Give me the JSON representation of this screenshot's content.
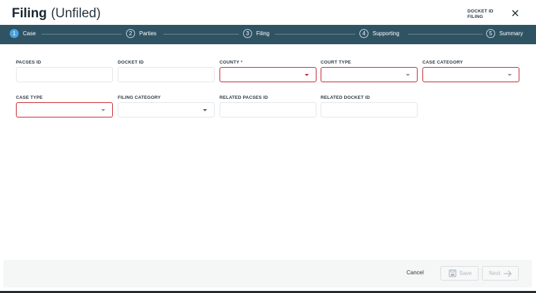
{
  "header": {
    "title": "Filing",
    "subtitle": "(Unfiled)",
    "docket_label": "DOCKET ID",
    "filing_label": "FILING"
  },
  "stepper": {
    "steps": [
      {
        "number": "1",
        "label": "Case",
        "active": true
      },
      {
        "number": "2",
        "label": "Parties",
        "active": false
      },
      {
        "number": "3",
        "label": "Filing",
        "active": false
      },
      {
        "number": "4",
        "label": "Supporting",
        "active": false
      },
      {
        "number": "5",
        "label": "Summary",
        "active": false
      }
    ]
  },
  "form": {
    "pacses_id": {
      "label": "PACSES ID",
      "value": ""
    },
    "docket_id": {
      "label": "DOCKET ID",
      "value": ""
    },
    "county": {
      "label": "COUNTY",
      "required_mark": "*",
      "value": ""
    },
    "court_type": {
      "label": "COURT TYPE",
      "value": ""
    },
    "case_category": {
      "label": "CASE CATEGORY",
      "value": ""
    },
    "case_type": {
      "label": "CASE TYPE",
      "value": ""
    },
    "filing_category": {
      "label": "FILING CATEGORY",
      "value": ""
    },
    "related_pacses_id": {
      "label": "RELATED PACSES ID",
      "value": ""
    },
    "related_docket_id": {
      "label": "RELATED DOCKET ID",
      "value": ""
    }
  },
  "footer": {
    "cancel_label": "Cancel",
    "save_label": "Save",
    "next_label": "Next"
  },
  "colors": {
    "stepper_bg": "#2f5363",
    "active_step": "#4aa3df",
    "error_border": "#c8262e",
    "required": "#d2232a"
  }
}
